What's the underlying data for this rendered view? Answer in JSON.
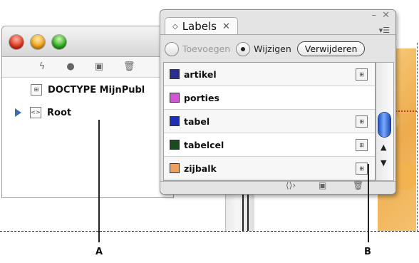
{
  "structure_window": {
    "toolbar_icons": [
      "lightning-icon",
      "dot-icon",
      "new-element-icon",
      "trash-icon"
    ],
    "tree": [
      {
        "label": "DOCTYPE MijnPubl",
        "icon": "doctype-icon"
      },
      {
        "label": "Root",
        "icon": "element-tag-icon"
      }
    ]
  },
  "labels_panel": {
    "tab_title": "Labels",
    "radio_add": "Toevoegen",
    "radio_change": "Wijzigen",
    "delete_button": "Verwijderen",
    "rows": [
      {
        "name": "artikel",
        "color": "#2b2d8f",
        "has_icon": true
      },
      {
        "name": "porties",
        "color": "#cf57d6",
        "has_icon": false
      },
      {
        "name": "tabel",
        "color": "#1c2fb6",
        "has_icon": true
      },
      {
        "name": "tabelcel",
        "color": "#1a4a1e",
        "has_icon": true
      },
      {
        "name": "zijbalk",
        "color": "#f0a05e",
        "has_icon": true
      }
    ],
    "footer_icons": [
      "tag-map-icon",
      "new-label-icon",
      "trash-icon"
    ]
  },
  "callouts": {
    "a": "A",
    "b": "B"
  }
}
